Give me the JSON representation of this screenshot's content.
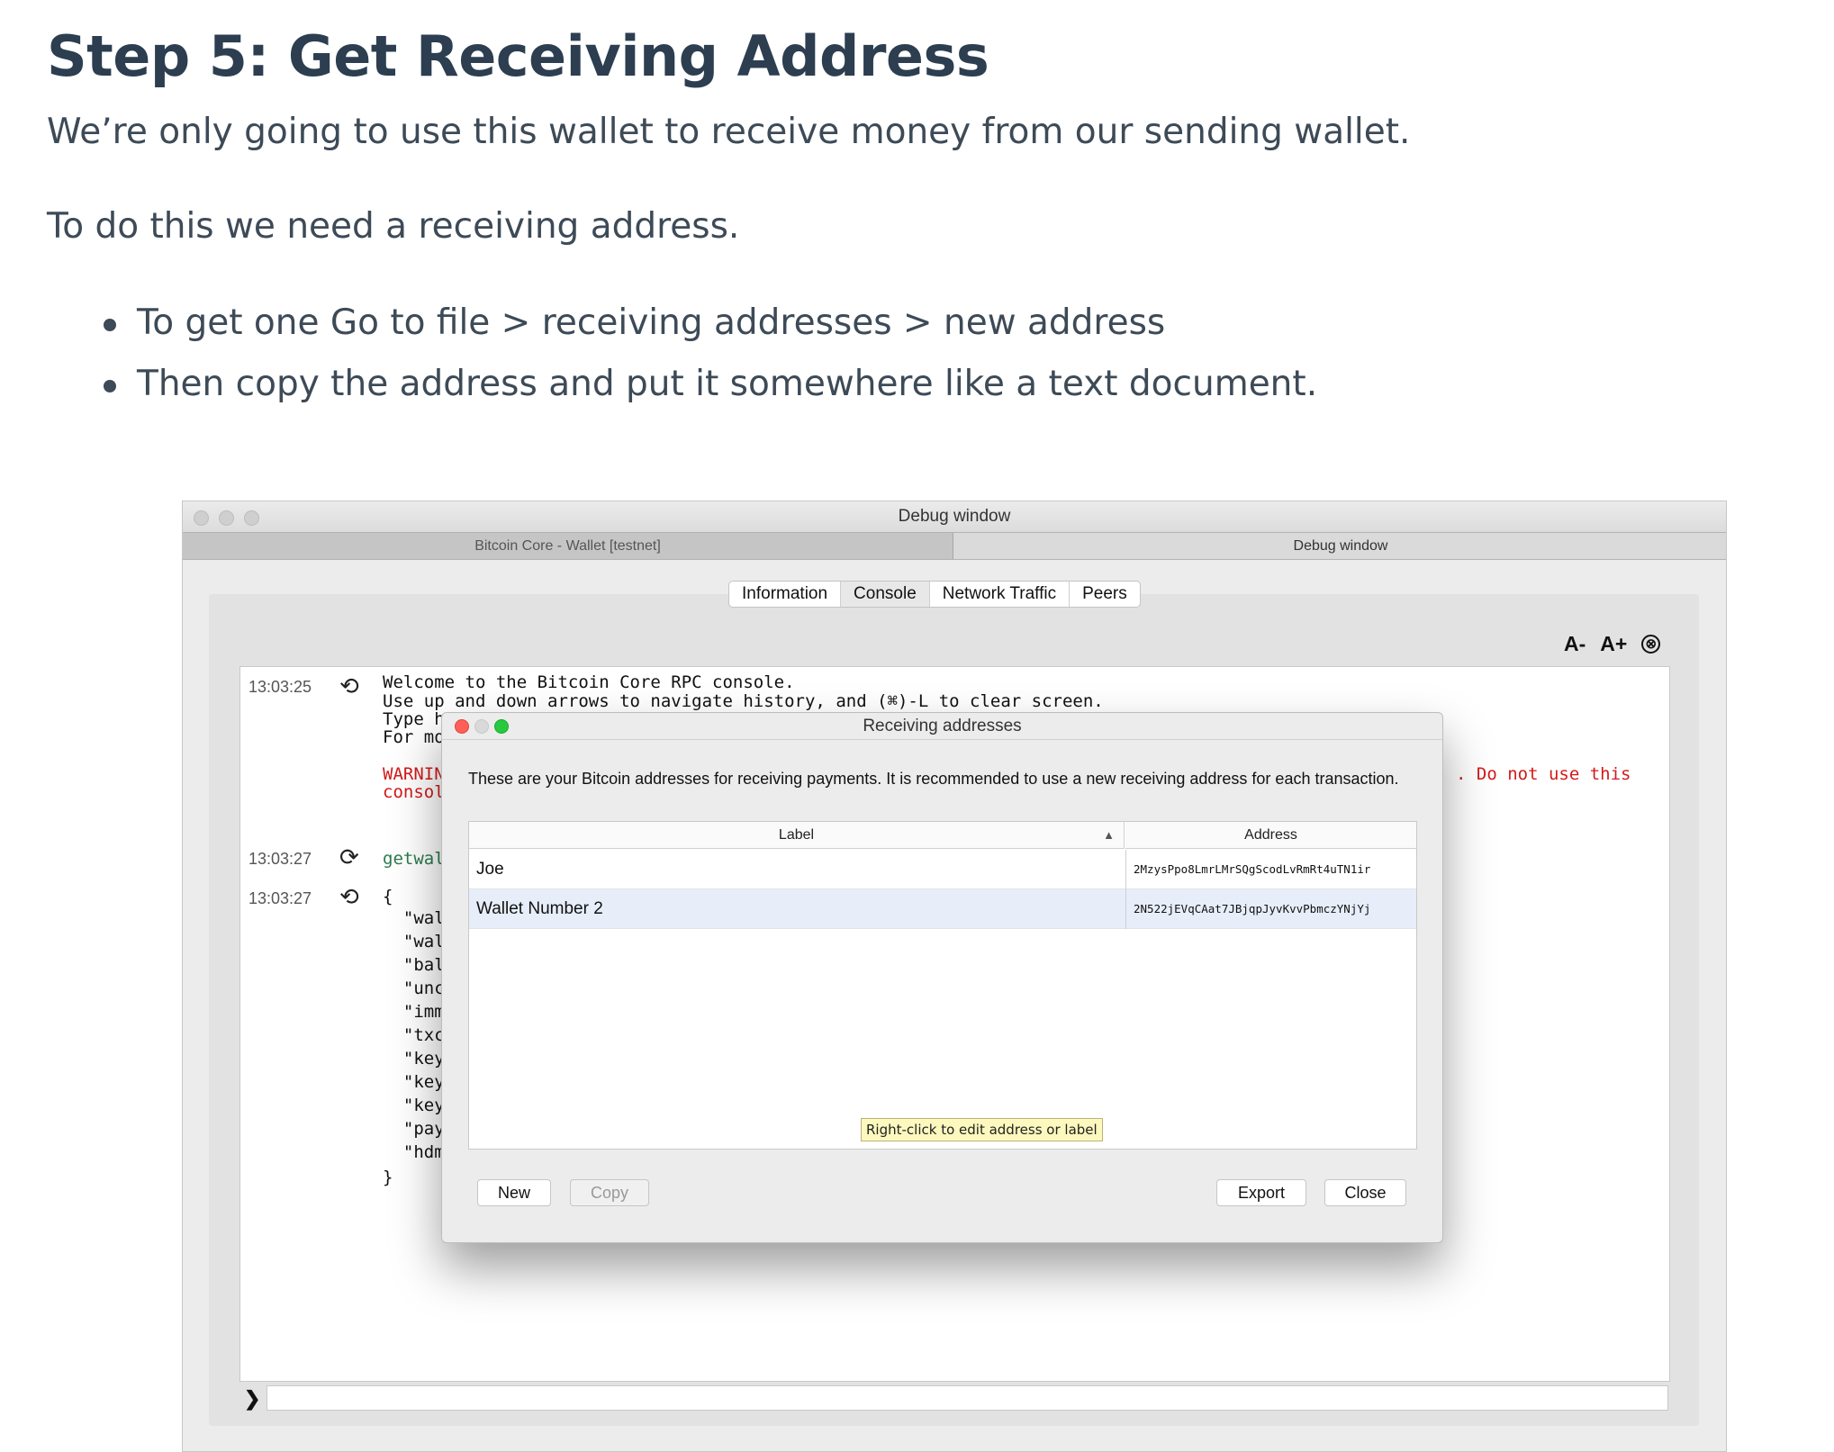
{
  "article": {
    "title": "Step 5: Get Receiving Address",
    "para1": "We’re only going to use this wallet to receive money from our sending wallet.",
    "para2": "To do this we need a receiving address.",
    "bullets": [
      "To get one Go to file > receiving addresses > new address",
      "Then copy the address and put it somewhere like a text document."
    ]
  },
  "debug_window": {
    "title": "Debug window",
    "doc_tabs": [
      "Bitcoin Core - Wallet [testnet]",
      "Debug window"
    ],
    "tabs": [
      "Information",
      "Console",
      "Network Traffic",
      "Peers"
    ],
    "active_tab": "Console",
    "font_decrease": "A-",
    "font_increase": "A+",
    "clear_icon": "⊗",
    "prompt_icon": "❯",
    "console": {
      "times": [
        "13:03:25",
        "13:03:27",
        "13:03:27"
      ],
      "lines": [
        "Welcome to the Bitcoin Core RPC console.",
        "Use up and down arrows to navigate history, and (⌘)-L to clear screen.",
        "Type h",
        "For mo",
        "WARNIN",
        "consol",
        "getwal",
        "{",
        "  \"wal",
        "  \"wal",
        "  \"bal",
        "  \"unc",
        "  \"imm",
        "  \"txc",
        "  \"key",
        "  \"key",
        "  \"key",
        "  \"pay",
        "  \"hdm",
        "}"
      ],
      "warning_tail": ". Do not use this"
    }
  },
  "receiving_dialog": {
    "title": "Receiving addresses",
    "description": "These are your Bitcoin addresses for receiving payments. It is recommended to use a new receiving address for each transaction.",
    "columns": [
      "Label",
      "Address"
    ],
    "sort_indicator": "▲",
    "rows": [
      {
        "label": "Joe",
        "address": "2MzysPpo8LmrLMrSQgScodLvRmRt4uTN1ir"
      },
      {
        "label": "Wallet Number 2",
        "address": "2N522jEVqCAat7JBjqpJyvKvvPbmczYNjYj"
      }
    ],
    "tooltip": "Right-click to edit address or label",
    "buttons": {
      "new": "New",
      "copy": "Copy",
      "export": "Export",
      "close": "Close"
    }
  },
  "colors": {
    "heading": "#2c3e50",
    "warning_red": "#d31a1a",
    "command_green": "#2b7a4b",
    "close_dot": "#fe5f57",
    "zoom_dot": "#28c840",
    "tooltip_bg": "#fdf8be"
  }
}
